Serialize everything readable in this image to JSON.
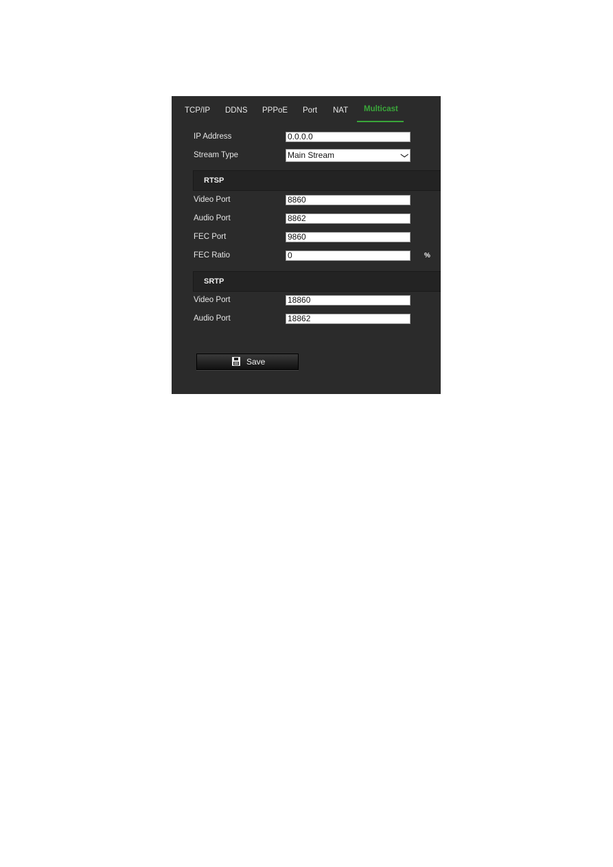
{
  "tabs": [
    {
      "label": "TCP/IP"
    },
    {
      "label": "DDNS"
    },
    {
      "label": "PPPoE"
    },
    {
      "label": "Port"
    },
    {
      "label": "NAT"
    },
    {
      "label": "Multicast",
      "active": true
    }
  ],
  "accent_color": "#3aa63a",
  "form": {
    "ip_address": {
      "label": "IP Address",
      "value": "0.0.0.0"
    },
    "stream_type": {
      "label": "Stream Type",
      "value": "Main Stream"
    }
  },
  "rtsp": {
    "title": "RTSP",
    "video_port": {
      "label": "Video Port",
      "value": "8860"
    },
    "audio_port": {
      "label": "Audio Port",
      "value": "8862"
    },
    "fec_port": {
      "label": "FEC Port",
      "value": "9860"
    },
    "fec_ratio": {
      "label": "FEC Ratio",
      "value": "0",
      "unit": "%"
    }
  },
  "srtp": {
    "title": "SRTP",
    "video_port": {
      "label": "Video Port",
      "value": "18860"
    },
    "audio_port": {
      "label": "Audio Port",
      "value": "18862"
    }
  },
  "save": {
    "label": "Save",
    "icon": "floppy-disk-icon"
  }
}
